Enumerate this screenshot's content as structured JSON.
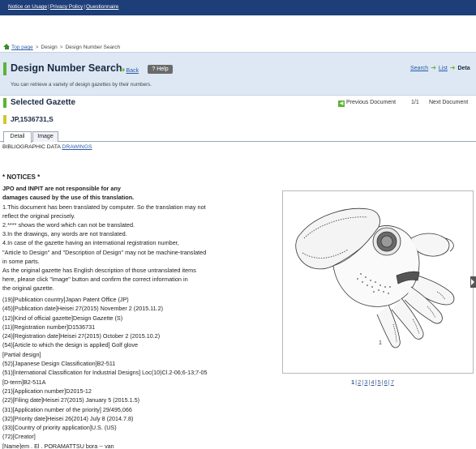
{
  "topbar": {
    "links": [
      "Notice on Usage",
      "Privacy Policy",
      "Questionnaire"
    ]
  },
  "breadcrumb": {
    "home": "Top page",
    "items": [
      "Design",
      "Design Number Search"
    ]
  },
  "header": {
    "title": "Design Number Search",
    "back_label": "Back",
    "help_label": "? Help",
    "subtitle": "You can retrieve a variety of design gazettes by their numbers.",
    "steps": [
      "Search",
      "List",
      "Deta"
    ]
  },
  "selected": {
    "label": "Selected Gazette",
    "gazette_no": "JP,1536731,S",
    "prev_label": "Previous Document",
    "pages": "1/1",
    "next_label": "Next Document"
  },
  "tabs": [
    "Detail",
    "Image"
  ],
  "bibliographic": {
    "label": "BIBLIOGRAPHIC DATA",
    "drawings_link": "DRAWINGS"
  },
  "notices": {
    "title": "* NOTICES *",
    "warning_lines": [
      "JPO and INPIT are not responsible for any",
      "damages caused by the use of this translation."
    ],
    "lines": [
      "1.This document has been translated by computer. So the translation may not",
      "reflect the original precisely.",
      "2.**** shows the word which can not be translated.",
      "3.In the drawings, any words are not translated.",
      "4.In case of the gazette having an international registration number,",
      "\"Article to Design\" and \"Description of Design\" may not be machine-translated",
      "in some parts.",
      "As the original gazette has English description of those untranslated items",
      "here, please click \"Image\" button and confirm the correct information in",
      "the original gazette."
    ]
  },
  "biblio_items": [
    "(19)[Publication country]Japan Patent Office (JP)",
    "(45)[Publication date]Heisei 27(2015) November 2 (2015.11.2)",
    "(12)[Kind of official gazette]Design Gazette (S)",
    "(11)[Registration number]D1536731",
    "(24)[Registration date]Heisei 27(2015) October 2 (2015.10.2)",
    "(54)[Article to which the design is applied] Golf glove",
    "[Partial design]",
    "(52)[Japanese Design Classification]B2-511",
    "(51)[International Classification for Industrial Designs] Loc(10)Cl.2-06;6-13;7-05",
    "[D-term]B2-511A",
    "(21)[Application number]D2015-12",
    "(22)[Filing date]Heisei 27(2015) January 5 (2015.1.5)",
    "(31)[Application number of the priority] 29/495,066",
    "(32)[Priority date]Heisei 26(2014) July 8 (2014.7.8)",
    "(33)[Country of priority application]U.S. (US)",
    "(72)[Creator]",
    "[Name]em . El . PORAMATTSU bora -- van"
  ],
  "image": {
    "page_number": "1",
    "nav": [
      "1",
      "2",
      "3",
      "4",
      "5",
      "6",
      "7"
    ]
  }
}
